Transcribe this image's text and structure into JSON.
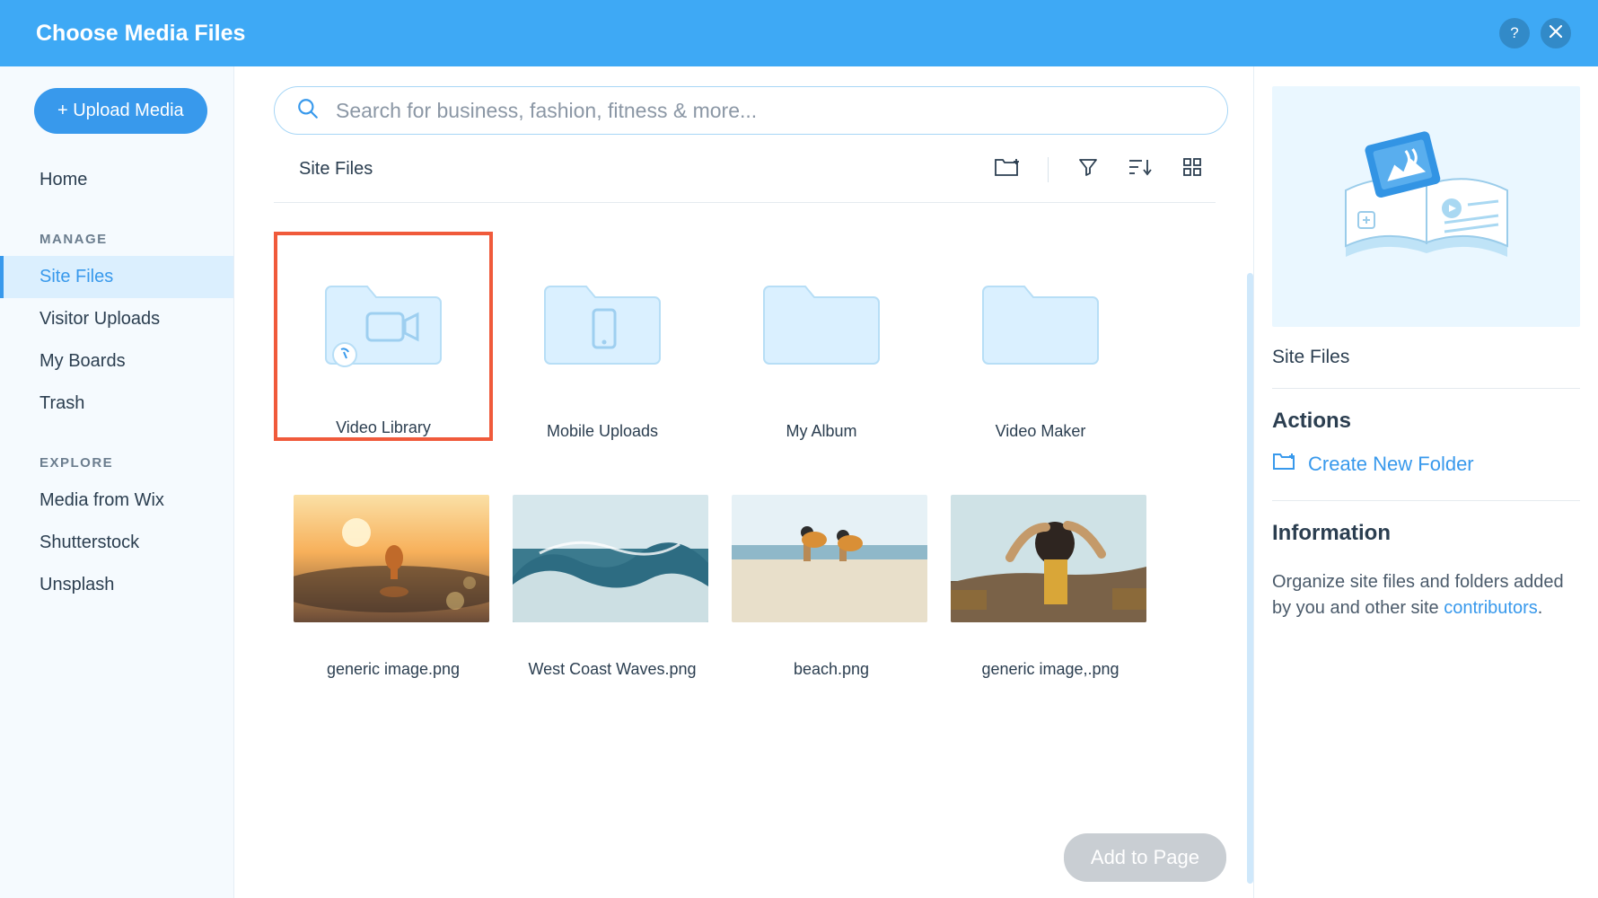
{
  "header": {
    "title": "Choose Media Files"
  },
  "sidebar": {
    "upload_label": "+ Upload Media",
    "home": "Home",
    "manage_title": "MANAGE",
    "manage_items": [
      "Site Files",
      "Visitor Uploads",
      "My Boards",
      "Trash"
    ],
    "explore_title": "EXPLORE",
    "explore_items": [
      "Media from Wix",
      "Shutterstock",
      "Unsplash"
    ]
  },
  "search": {
    "placeholder": "Search for business, fashion, fitness & more..."
  },
  "content": {
    "title": "Site Files",
    "folders": [
      "Video Library",
      "Mobile Uploads",
      "My Album",
      "Video Maker"
    ],
    "files": [
      "generic image.png",
      "West Coast Waves.png",
      "beach.png",
      "generic image,.png"
    ]
  },
  "rpanel": {
    "title": "Site Files",
    "actions_title": "Actions",
    "create_folder": "Create New Folder",
    "info_title": "Information",
    "info_text_1": "Organize site files and folders added by you and other site ",
    "info_link": "contributors",
    "info_text_2": "."
  },
  "footer": {
    "add_label": "Add to Page"
  }
}
